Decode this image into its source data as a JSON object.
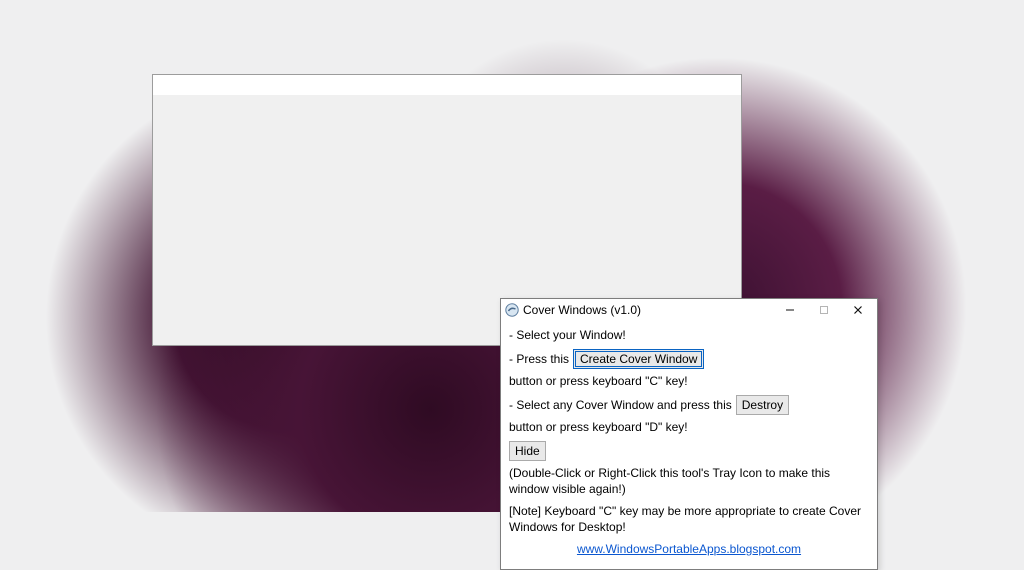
{
  "dialog": {
    "title": "Cover Windows (v1.0)",
    "line1": "- Select your Window!",
    "line2_pre": "- Press this",
    "create_btn": "Create Cover Window",
    "line2_post": "button or press keyboard \"C\" key!",
    "line3_pre": "- Select any Cover Window and press this",
    "destroy_btn": "Destroy",
    "line3_post": "button or press keyboard \"D\" key!",
    "hide_btn": "Hide",
    "line4_post": "(Double-Click or Right-Click this tool's Tray Icon to make this window visible again!)",
    "note": "[Note] Keyboard \"C\" key may be more appropriate to create Cover Windows for Desktop!",
    "link": "www.WindowsPortableApps.blogspot.com"
  }
}
